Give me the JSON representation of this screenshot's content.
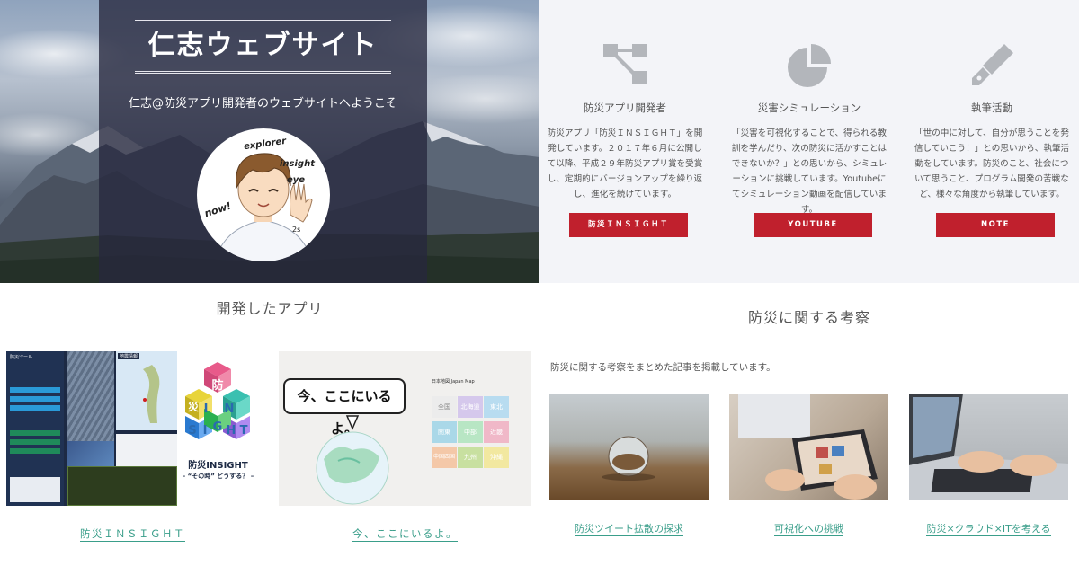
{
  "hero": {
    "site_title": "仁志ウェブサイト",
    "subtitle": "仁志@防災アプリ開発者のウェブサイトへようこそ",
    "avatar": {
      "icon": "illustrated-waving-person",
      "words": [
        "explorer",
        "insight",
        "eye",
        "now!",
        "2s"
      ]
    }
  },
  "services": [
    {
      "icon": "flowchart-icon",
      "title": "防災アプリ開発者",
      "text": "防災アプリ「防災ＩＮＳＩＧＨＴ」を開発しています。２０１７年６月に公開して以降、平成２９年防災アプリ賞を受賞し、定期的にバージョンアップを繰り返し、進化を続けています。",
      "button": "防災ＩＮＳＩＧＨＴ"
    },
    {
      "icon": "pie-chart-icon",
      "title": "災害シミュレーション",
      "text": "「災害を可視化することで、得られる教訓を学んだり、次の防災に活かすことはできないか？」との思いから、シミュレーションに挑戦しています。Youtubeにてシミュレーション動画を配信しています。",
      "button": "YOUTUBE"
    },
    {
      "icon": "pen-icon",
      "title": "執筆活動",
      "text": "「世の中に対して、自分が思うことを発信していこう！」との思いから、執筆活動をしています。防災のこと、社会について思うこと、プログラム開発の苦戦など、様々な角度から執筆しています。",
      "button": "NOTE"
    }
  ],
  "apps": {
    "heading": "開発したアプリ",
    "items": [
      {
        "label": "防災ＩＮＳＩＧＨＴ",
        "thumb": {
          "panel_header": "防災ツール",
          "map_header": "地震情報",
          "logo_chars": [
            "防",
            "災",
            "I",
            "N",
            "S",
            "I",
            "G",
            "H",
            "T"
          ],
          "logo_title": "防災INSIGHT",
          "logo_tagline": "– “その時” どうする？ –"
        }
      },
      {
        "label": "今、ここにいるよ。",
        "thumb": {
          "bubble": "今、ここにいるよ。",
          "map_title": "日本地図 Japan Map",
          "regions": [
            "全国",
            "北海道",
            "東北",
            "関東",
            "中部",
            "近畿",
            "中国四国",
            "九州",
            "沖縄"
          ]
        }
      }
    ]
  },
  "disaster": {
    "heading": "防災に関する考察",
    "intro": "防災に関する考察をまとめた記事を掲載しています。",
    "articles": [
      {
        "label": "防災ツイート拡散の探求",
        "thumb": "crystal-ball-photo"
      },
      {
        "label": "可視化への挑戦",
        "thumb": "tablet-photo"
      },
      {
        "label": "防災×クラウド×ITを考える",
        "thumb": "laptop-typing-photo"
      }
    ]
  }
}
